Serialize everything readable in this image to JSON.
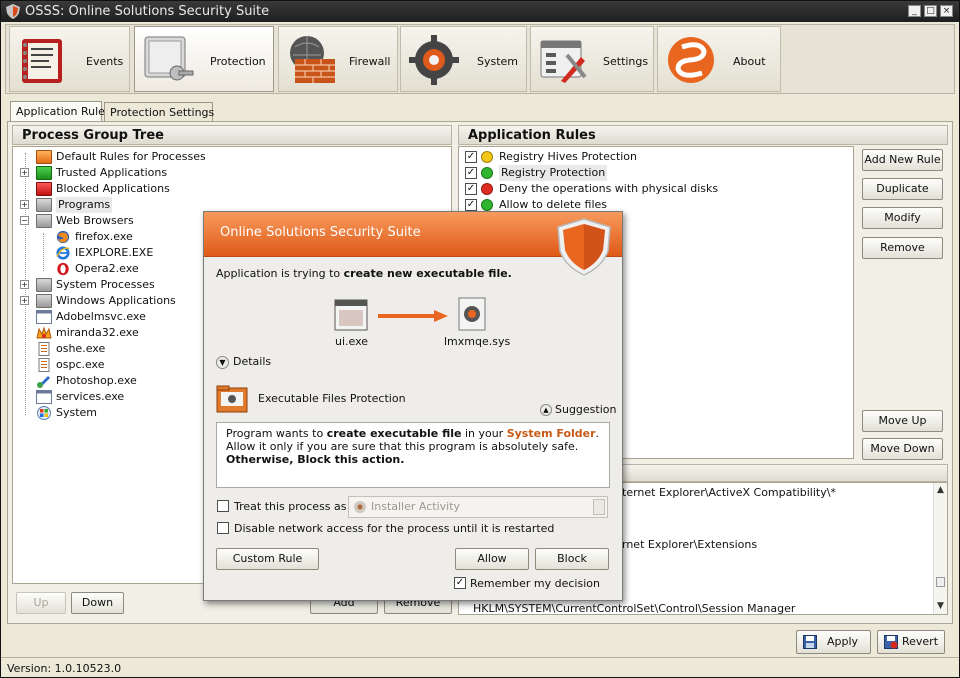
{
  "window": {
    "title": "OSSS: Online Solutions Security Suite",
    "minimize": "_",
    "maximize": "□",
    "close": "×"
  },
  "toolbar": {
    "buttons": [
      {
        "label": "Events",
        "icon": "events-book-icon"
      },
      {
        "label": "Protection",
        "icon": "protection-key-icon"
      },
      {
        "label": "Firewall",
        "icon": "firewall-globe-icon"
      },
      {
        "label": "System",
        "icon": "system-gear-icon"
      },
      {
        "label": "Settings",
        "icon": "settings-tools-icon"
      },
      {
        "label": "About",
        "icon": "about-logo-icon"
      }
    ]
  },
  "tabs": [
    "Application Rules",
    "Protection Settings"
  ],
  "tree": {
    "title": "Process Group Tree",
    "items": [
      {
        "label": "Default Rules for Processes",
        "icon": "orange-folder-icon"
      },
      {
        "label": "Trusted Applications",
        "icon": "green-folder-icon"
      },
      {
        "label": "Blocked Applications",
        "icon": "red-folder-icon"
      },
      {
        "label": "Programs",
        "icon": "folder-icon"
      },
      {
        "label": "Web Browsers",
        "icon": "folder-open-icon"
      },
      {
        "label": "firefox.exe",
        "icon": "firefox-icon"
      },
      {
        "label": "IEXPLORE.EXE",
        "icon": "ie-icon"
      },
      {
        "label": "Opera2.exe",
        "icon": "opera-icon"
      },
      {
        "label": "System Processes",
        "icon": "folder-icon"
      },
      {
        "label": "Windows Applications",
        "icon": "folder-icon"
      },
      {
        "label": "Adobelmsvc.exe",
        "icon": "app-window-icon"
      },
      {
        "label": "miranda32.exe",
        "icon": "miranda-icon"
      },
      {
        "label": "oshe.exe",
        "icon": "document-icon"
      },
      {
        "label": "ospc.exe",
        "icon": "document-icon"
      },
      {
        "label": "Photoshop.exe",
        "icon": "photoshop-icon"
      },
      {
        "label": "services.exe",
        "icon": "app-window-icon"
      },
      {
        "label": "System",
        "icon": "windows-icon"
      }
    ],
    "up": "Up",
    "down": "Down"
  },
  "rules": {
    "title": "Application Rules",
    "items": [
      {
        "label": "Registry Hives Protection",
        "color": "#f2c612"
      },
      {
        "label": "Registry Protection",
        "color": "#2fb52f"
      },
      {
        "label": "Deny the operations with physical disks",
        "color": "#e12a1f"
      },
      {
        "label": "Allow to delete files",
        "color": "#2fb52f"
      }
    ],
    "buttons": {
      "add": "Add New Rule",
      "duplicate": "Duplicate",
      "modify": "Modify",
      "remove": "Remove",
      "move_up": "Move Up",
      "move_down": "Move Down"
    }
  },
  "registry": {
    "rows": [
      "ternet Explorer\\ActiveX Compatibility\\*",
      "rnet Explorer\\Extensions",
      "HKLM\\SYSTEM\\CurrentControlSet\\Control\\Session Manager"
    ],
    "add": "Add",
    "remove": "Remove"
  },
  "footer": {
    "version": "Version: 1.0.10523.0",
    "apply": "Apply",
    "revert": "Revert"
  },
  "dialog": {
    "title": "Online Solutions Security Suite",
    "message_prefix": "Application is trying to ",
    "message_bold": "create new executable file.",
    "source": "ui.exe",
    "target": "lmxmqe.sys",
    "details": "Details",
    "module": "Executable Files Protection",
    "suggestion": "Suggestion",
    "info_prefix": "Program wants to ",
    "info_bold": "create executable file",
    "info_mid": " in your ",
    "info_highlight": "System Folder",
    "info_end": ".",
    "info_line2": "Allow it only if you are sure that this program is absolutely safe.",
    "info_line3": "Otherwise, Block this action.",
    "treat_label": "Treat this process as",
    "treat_value": "Installer Activity",
    "disable_net": "Disable network access for the process until it is restarted",
    "custom_rule": "Custom Rule",
    "allow": "Allow",
    "block": "Block",
    "remember": "Remember my decision"
  },
  "colors": {
    "accent_orange": "#e8661f",
    "highlight": "#c85a14"
  }
}
